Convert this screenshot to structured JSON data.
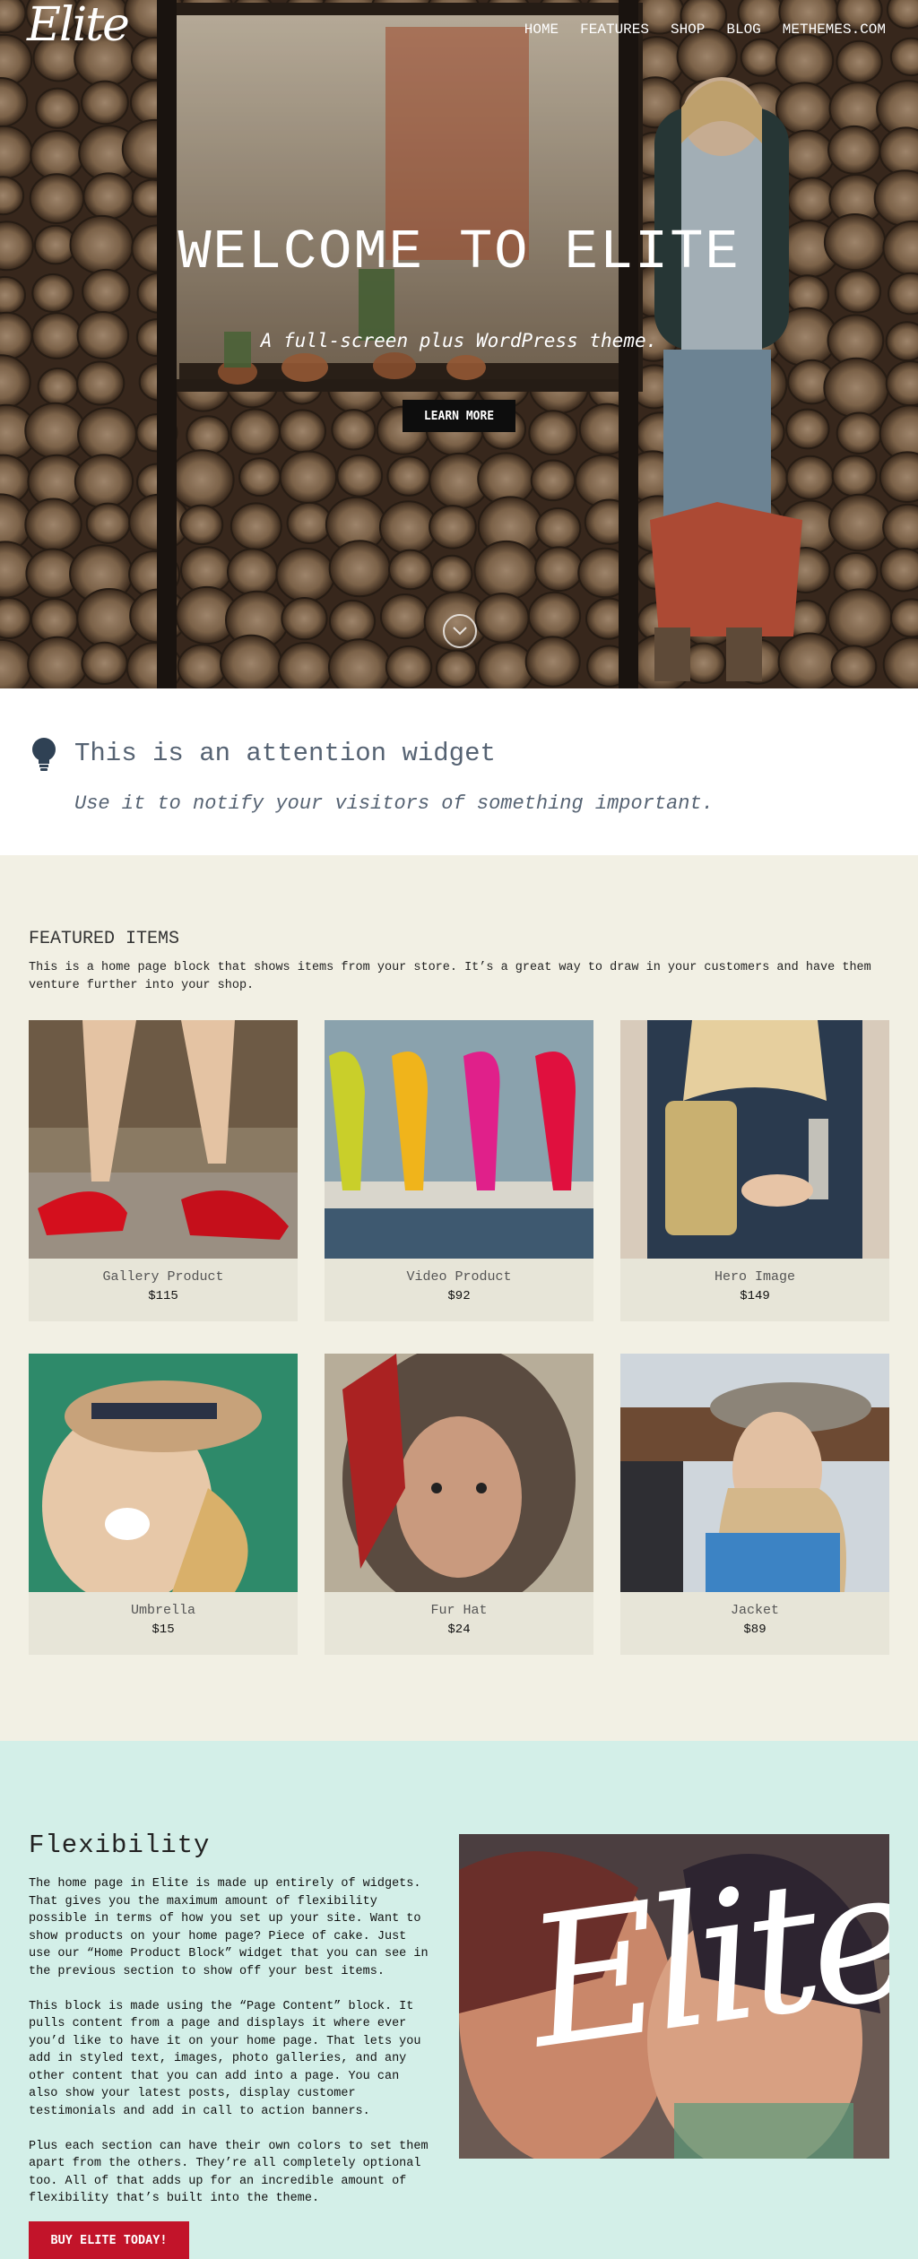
{
  "header": {
    "logo": "Elite",
    "nav": [
      "HOME",
      "FEATURES",
      "SHOP",
      "BLOG",
      "METHEMES.COM"
    ]
  },
  "hero": {
    "title": "WELCOME TO ELITE",
    "subtitle": "A full-screen plus WordPress theme.",
    "button": "LEARN MORE",
    "scroll_icon": "chevron-down-circle-icon"
  },
  "attention": {
    "icon": "lightbulb-icon",
    "title": "This is an attention widget",
    "text": "Use it to notify your visitors of something important."
  },
  "featured": {
    "heading": "FEATURED ITEMS",
    "intro": "This is a home page block that shows items from your store. It’s a great way to draw in your customers and have them venture further into your shop.",
    "items": [
      {
        "name": "Gallery Product",
        "price": "$115"
      },
      {
        "name": "Video Product",
        "price": "$92"
      },
      {
        "name": "Hero Image",
        "price": "$149"
      },
      {
        "name": "Umbrella",
        "price": "$15"
      },
      {
        "name": "Fur Hat",
        "price": "$24"
      },
      {
        "name": "Jacket",
        "price": "$89"
      }
    ]
  },
  "flexibility": {
    "heading": "Flexibility",
    "paragraphs": [
      "The home page in Elite is made up entirely of widgets. That gives you the maximum amount of flexibility possible in terms of how you set up your site. Want to show products on your home page? Piece of cake. Just use our “Home Product Block” widget that you can see in the previous section to show off your best items.",
      "This block is made using the “Page Content” block. It pulls content from a page and displays it where ever you’d like to have it on your home page. That lets you add in styled text, images, photo galleries, and any other content that you can add into a page. You can also show your latest posts, display customer testimonials and add in call to action banners.",
      "Plus each section can have their own colors to set them apart from the others. They’re all completely optional too. All of that adds up for an incredible amount of flexibility that’s built into the theme."
    ],
    "button": "BUY ELITE TODAY!",
    "photo_logo": "Elite"
  },
  "colors": {
    "featured_bg": "#f2f0e4",
    "flex_bg": "#d3efe8",
    "buy_button": "#c2142a",
    "attention_text": "#566373"
  }
}
